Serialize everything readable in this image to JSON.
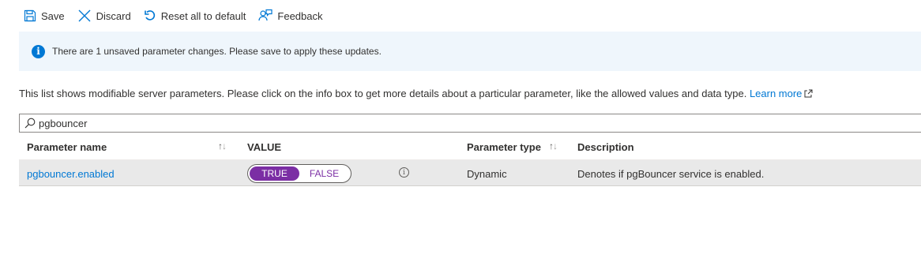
{
  "toolbar": {
    "save_label": "Save",
    "discard_label": "Discard",
    "reset_label": "Reset all to default",
    "feedback_label": "Feedback"
  },
  "banner": {
    "message": "There are 1 unsaved parameter changes.  Please save to apply these updates.",
    "icon": "info-icon"
  },
  "description": {
    "text": "This list shows modifiable server parameters. Please click on the info box to get more details about a particular parameter, like the allowed values and data type.",
    "link_label": "Learn more"
  },
  "search": {
    "value": "pgbouncer",
    "icon": "search-icon"
  },
  "table": {
    "columns": {
      "name": "Parameter name",
      "value": "VALUE",
      "type": "Parameter type",
      "description": "Description"
    },
    "rows": [
      {
        "name": "pgbouncer.enabled",
        "toggle_true": "TRUE",
        "toggle_false": "FALSE",
        "selected": "TRUE",
        "type": "Dynamic",
        "description": "Denotes if pgBouncer service is enabled."
      }
    ]
  },
  "colors": {
    "accent": "#0078d4",
    "toggle_selected": "#7b2ea4",
    "banner_bg": "#eff6fc"
  }
}
